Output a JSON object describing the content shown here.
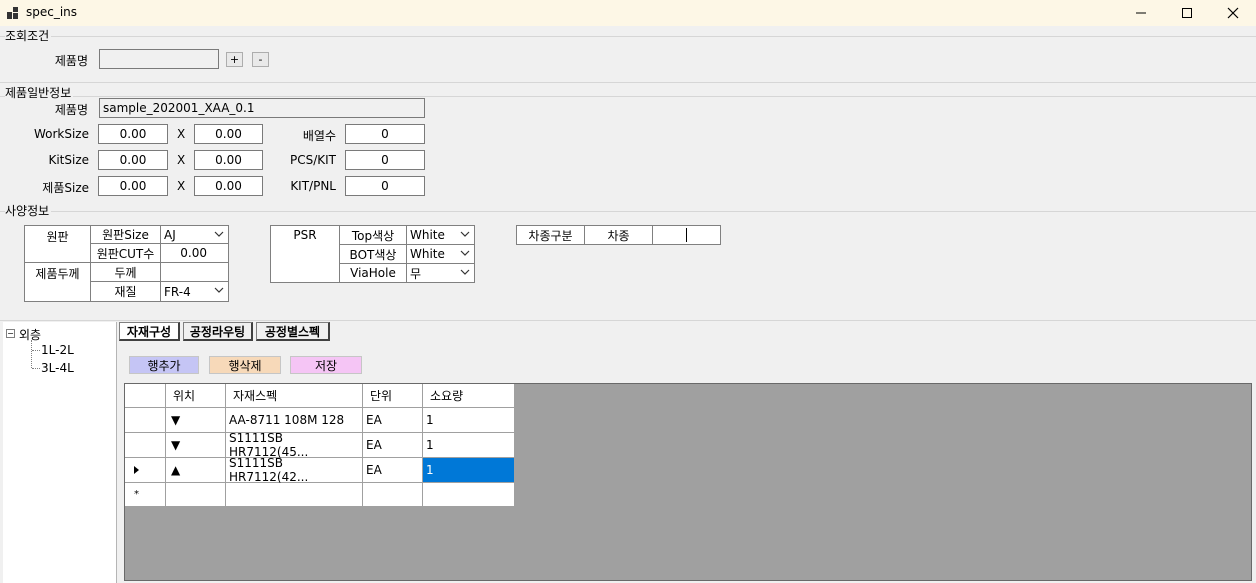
{
  "window": {
    "title": "spec_ins",
    "minimize_icon": "minimize-icon",
    "maximize_icon": "maximize-icon",
    "close_icon": "close-icon"
  },
  "query": {
    "group_title": "조회조건",
    "product_label": "제품명",
    "product_value": "",
    "plus_label": "+",
    "minus_label": "-"
  },
  "general": {
    "group_title": "제품일반정보",
    "product_label": "제품명",
    "product_value": "sample_202001_XAA_0.1",
    "worksize_label": "WorkSize",
    "worksize_x": "0.00",
    "worksize_y": "0.00",
    "kitsize_label": "KitSize",
    "kitsize_x": "0.00",
    "kitsize_y": "0.00",
    "prodsize_label": "제품Size",
    "prodsize_x": "0.00",
    "prodsize_y": "0.00",
    "x_sep": "X",
    "array_label": "배열수",
    "array_value": "0",
    "pcs_label": "PCS/KIT",
    "pcs_value": "0",
    "kit_label": "KIT/PNL",
    "kit_value": "0"
  },
  "spec": {
    "group_title": "사양정보",
    "panel_label": "원판",
    "panel_size_label": "원판Size",
    "panel_size_value": "AJ",
    "panel_cut_label": "원판CUT수",
    "panel_cut_value": "0.00",
    "thickness_group_label": "제품두께",
    "thickness_label": "두께",
    "thickness_value": "",
    "material_label": "재질",
    "material_value": "FR-4",
    "psr_label": "PSR",
    "top_color_label": "Top색상",
    "top_color_value": "White",
    "bot_color_label": "BOT색상",
    "bot_color_value": "White",
    "viahole_label": "ViaHole",
    "viahole_value": "무",
    "car_type_label": "차종구분",
    "car_label": "차종",
    "car_value": ""
  },
  "tree": {
    "root": "외층",
    "children": [
      "1L-2L",
      "3L-4L"
    ]
  },
  "tabs": [
    "자재구성",
    "공정라우팅",
    "공정별스펙"
  ],
  "actions": {
    "add_row": "행추가",
    "delete_row": "행삭제",
    "save": "저장",
    "add_color": "#c5c5f5",
    "delete_color": "#f7d9b9",
    "save_color": "#f5c5f5"
  },
  "grid": {
    "columns": [
      "위치",
      "자재스펙",
      "단위",
      "소요량"
    ],
    "rows": [
      {
        "position": "▼",
        "spec": "AA-8711 108M 128",
        "unit": "EA",
        "qty": "1"
      },
      {
        "position": "▼",
        "spec": "S1111SB HR7112(45...",
        "unit": "EA",
        "qty": "1"
      },
      {
        "position": "▲",
        "spec": "S1111SB HR7112(42...",
        "unit": "EA",
        "qty": "1"
      }
    ],
    "selection_color": "#0078d7"
  }
}
